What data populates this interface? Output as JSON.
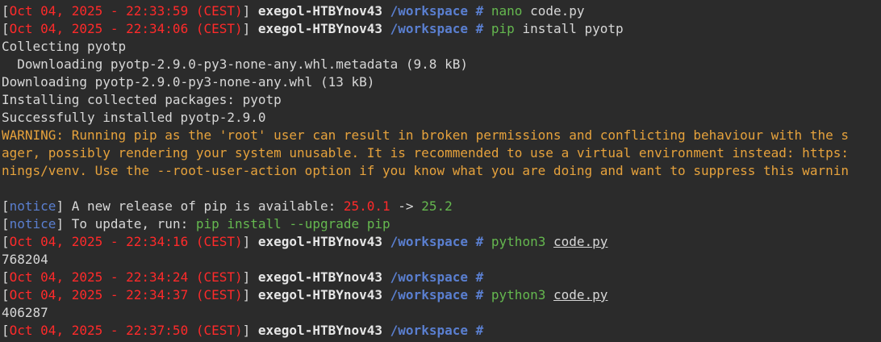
{
  "colors": {
    "background": "#2b2b2b",
    "foreground": "#d7d7d7",
    "timestamp": "#ff2a2a",
    "path": "#5a7fd0",
    "command": "#65b84f",
    "warning": "#e6a23c"
  },
  "prompt": {
    "host": "exegol-HTBYnov43",
    "cwd": "/workspace",
    "symbol": "#"
  },
  "lines": [
    {
      "type": "prompt",
      "ts": "Oct 04, 2025 - 22:33:59 (CEST)",
      "cmd": "nano",
      "arg": " code.py"
    },
    {
      "type": "prompt",
      "ts": "Oct 04, 2025 - 22:34:06 (CEST)",
      "cmd": "pip",
      "arg": " install pyotp"
    },
    {
      "type": "out",
      "text": "Collecting pyotp"
    },
    {
      "type": "out",
      "text": "  Downloading pyotp-2.9.0-py3-none-any.whl.metadata (9.8 kB)"
    },
    {
      "type": "out",
      "text": "Downloading pyotp-2.9.0-py3-none-any.whl (13 kB)"
    },
    {
      "type": "out",
      "text": "Installing collected packages: pyotp"
    },
    {
      "type": "out",
      "text": "Successfully installed pyotp-2.9.0"
    },
    {
      "type": "warn",
      "text": "WARNING: Running pip as the 'root' user can result in broken permissions and conflicting behaviour with the s"
    },
    {
      "type": "warn",
      "text": "ager, possibly rendering your system unusable. It is recommended to use a virtual environment instead: https:"
    },
    {
      "type": "warn",
      "text": "nings/venv. Use the --root-user-action option if you know what you are doing and want to suppress this warnin"
    },
    {
      "type": "blank",
      "text": ""
    },
    {
      "type": "notice1",
      "tag": "notice",
      "text": " A new release of pip is available: ",
      "old": "25.0.1",
      "arrow": " -> ",
      "new": "25.2"
    },
    {
      "type": "notice2",
      "tag": "notice",
      "text": " To update, run: ",
      "cmd": "pip install --upgrade pip"
    },
    {
      "type": "prompt",
      "ts": "Oct 04, 2025 - 22:34:16 (CEST)",
      "cmd": "python3",
      "argu": "code.py"
    },
    {
      "type": "out",
      "text": "768204"
    },
    {
      "type": "prompt",
      "ts": "Oct 04, 2025 - 22:34:24 (CEST)"
    },
    {
      "type": "prompt",
      "ts": "Oct 04, 2025 - 22:34:37 (CEST)",
      "cmd": "python3",
      "argu": "code.py"
    },
    {
      "type": "out",
      "text": "406287"
    },
    {
      "type": "prompt",
      "ts": "Oct 04, 2025 - 22:37:50 (CEST)"
    }
  ]
}
